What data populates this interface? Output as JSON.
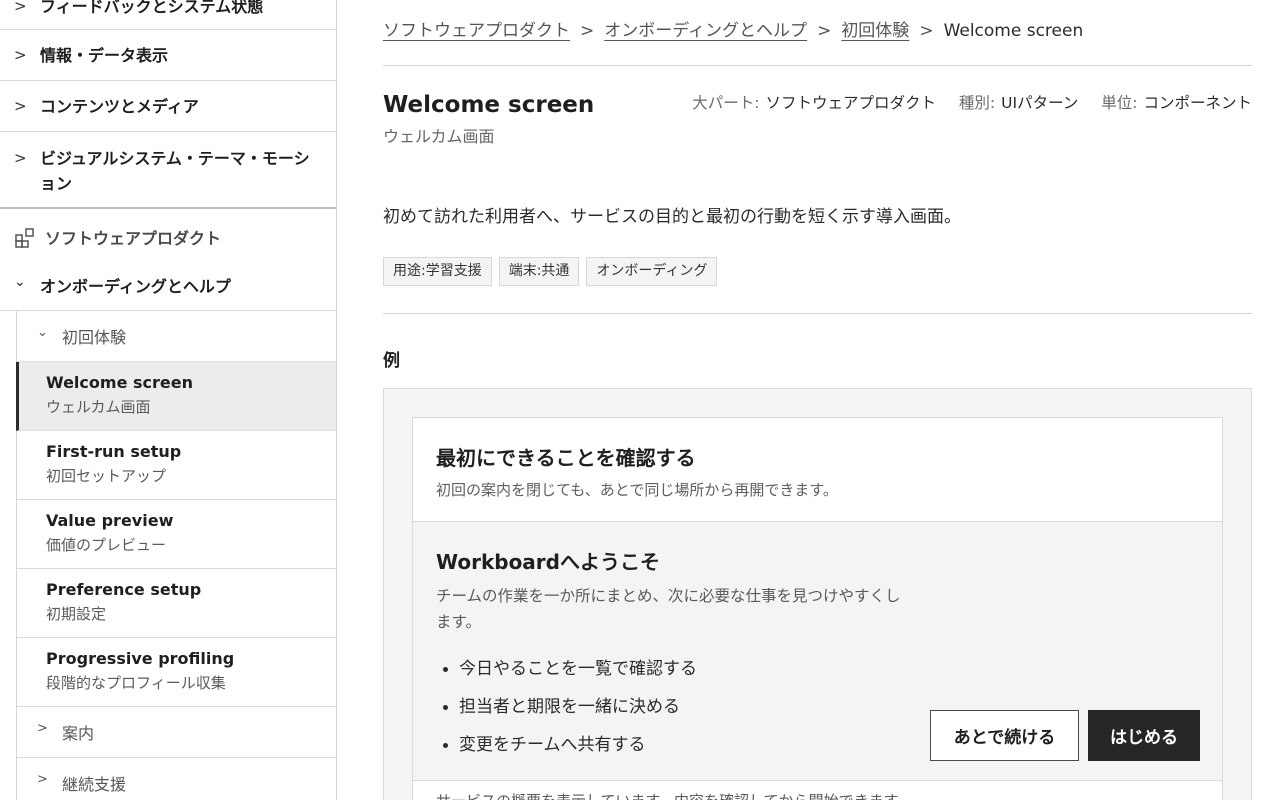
{
  "sidebar": {
    "categories": [
      {
        "label": "フィードバックとシステム状態"
      },
      {
        "label": "情報・データ表示"
      },
      {
        "label": "コンテンツとメディア"
      },
      {
        "label": "ビジュアルシステム・テーマ・モーション"
      }
    ],
    "root": {
      "label": "ソフトウェアプロダクト",
      "icon": "components-icon"
    },
    "section": {
      "label": "オンボーディングとヘルプ"
    },
    "subcategory_open": {
      "label": "初回体験"
    },
    "items": [
      {
        "en": "Welcome screen",
        "ja": "ウェルカム画面",
        "active": true
      },
      {
        "en": "First-run setup",
        "ja": "初回セットアップ"
      },
      {
        "en": "Value preview",
        "ja": "価値のプレビュー"
      },
      {
        "en": "Preference setup",
        "ja": "初期設定"
      },
      {
        "en": "Progressive profiling",
        "ja": "段階的なプロフィール収集"
      }
    ],
    "subcategories_closed": [
      {
        "label": "案内"
      },
      {
        "label": "継続支援"
      }
    ]
  },
  "breadcrumb": {
    "items": [
      "ソフトウェアプロダクト",
      "オンボーディングとヘルプ",
      "初回体験"
    ],
    "current": "Welcome screen",
    "separator": ">"
  },
  "page": {
    "title_en": "Welcome screen",
    "title_ja": "ウェルカム画面",
    "meta": [
      {
        "key": "大パート:",
        "value": "ソフトウェアプロダクト"
      },
      {
        "key": "種別:",
        "value": "UIパターン"
      },
      {
        "key": "単位:",
        "value": "コンポーネント"
      }
    ],
    "description": "初めて訪れた利用者へ、サービスの目的と最初の行動を短く示す導入画面。",
    "tags": [
      "用途:学習支援",
      "端末:共通",
      "オンボーディング"
    ]
  },
  "example": {
    "heading": "例",
    "card_title": "最初にできることを確認する",
    "card_subtitle": "初回の案内を閉じても、あとで同じ場所から再開できます。",
    "welcome_title": "Workboardへようこそ",
    "welcome_text": "チームの作業を一か所にまとめ、次に必要な仕事を見つけやすくします。",
    "bullets": [
      "今日やることを一覧で確認する",
      "担当者と期限を一緒に決める",
      "変更をチームへ共有する"
    ],
    "secondary_button": "あとで続ける",
    "primary_button": "はじめる",
    "footer_note": "サービスの概要を表示しています。内容を確認してから開始できます。"
  },
  "colors": {
    "primary_button_bg": "#262626",
    "active_item_bg": "#ececec",
    "example_bg": "#f5f5f5"
  }
}
